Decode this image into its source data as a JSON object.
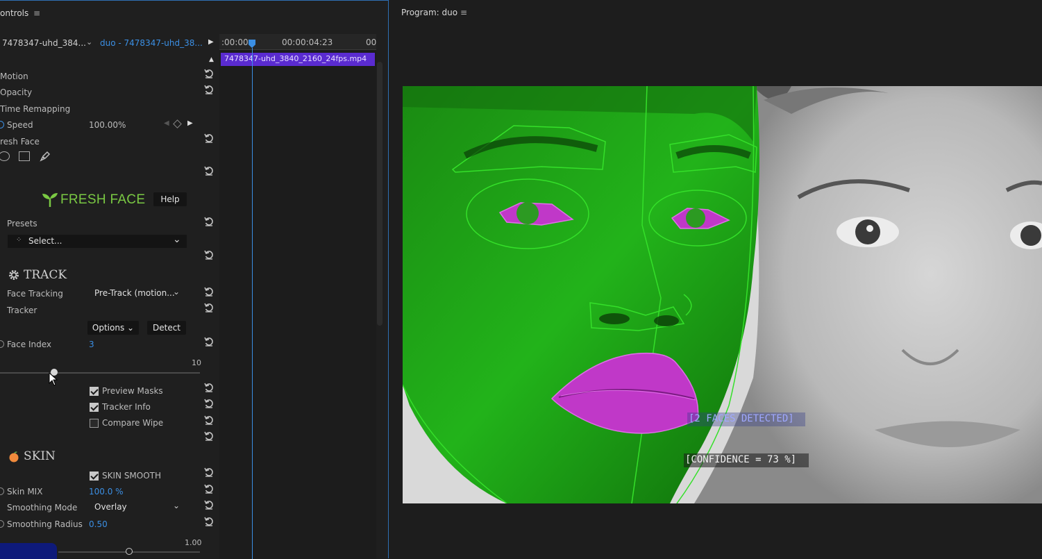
{
  "effect_controls": {
    "title": "ontrols",
    "clip_source": "7478347-uhd_384...",
    "clip_sequence": "duo - 7478347-uhd_38...",
    "timecode_start": ":00:00",
    "timecode_mid": "00:00:04:23",
    "timecode_end": "00",
    "clip_bar": "7478347-uhd_3840_2160_24fps.mp4",
    "motion": "Motion",
    "opacity": "Opacity",
    "time_remapping": "Time Remapping",
    "speed_label": "Speed",
    "speed_value": "100.00%",
    "fresh_face_label": "resh Face",
    "logo_text": "FRESH FACE",
    "help": "Help",
    "presets_label": "Presets",
    "presets_value": "Select...",
    "track_header": "TRACK",
    "face_tracking_label": "Face Tracking",
    "face_tracking_value": "Pre-Track (motion...",
    "tracker_label": "Tracker",
    "options": "Options",
    "detect": "Detect",
    "face_index_label": "Face Index",
    "face_index_value": "3",
    "face_index_max": "10",
    "face_index_fraction": 0.27,
    "preview_masks": "Preview Masks",
    "tracker_info": "Tracker Info",
    "compare_wipe": "Compare Wipe",
    "preview_masks_checked": true,
    "tracker_info_checked": true,
    "compare_wipe_checked": false,
    "skin_header": "SKIN",
    "skin_smooth": "SKIN SMOOTH",
    "skin_smooth_checked": true,
    "skin_mix_label": "Skin MIX",
    "skin_mix_value": "100.0 %",
    "smoothing_mode_label": "Smoothing Mode",
    "smoothing_mode_value": "Overlay",
    "smoothing_radius_label": "Smoothing Radius",
    "smoothing_radius_value": "0.50",
    "smoothing_radius_max": "1.00",
    "smoothing_radius_fraction": 0.5
  },
  "program_monitor": {
    "title": "Program: duo",
    "overlay_faces": "[2 FACES DETECTED]",
    "overlay_confidence": "[CONFIDENCE = 73 %]"
  },
  "colors": {
    "accent": "#2f6fb4",
    "clip": "#5a2bd0",
    "mask_green": "#22c41a",
    "mask_magenta": "#c038c8"
  }
}
